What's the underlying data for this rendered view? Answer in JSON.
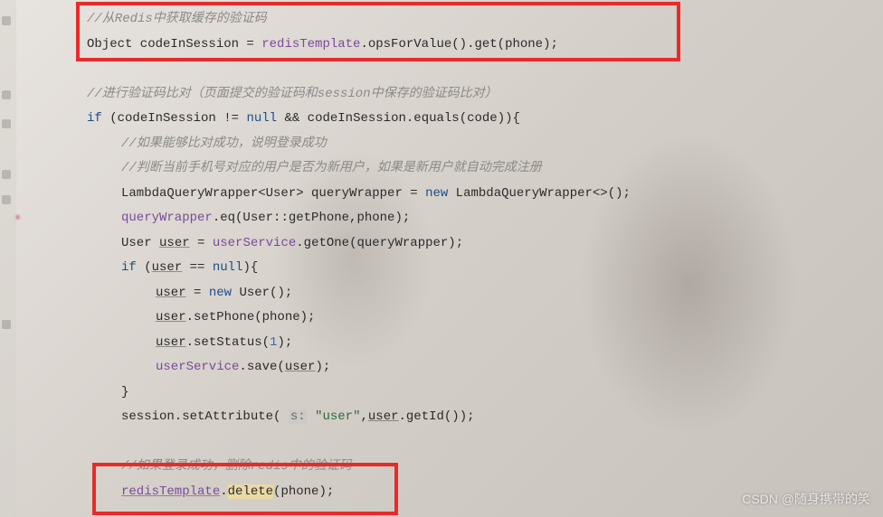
{
  "code": {
    "c1": "//从Redis中获取缓存的验证码",
    "l2a": "Object codeInSession = ",
    "l2b": "redisTemplate",
    "l2c": ".opsForValue().get(phone);",
    "c2": "//进行验证码比对（页面提交的验证码和session中保存的验证码比对）",
    "l4a": "if",
    "l4b": " (codeInSession != ",
    "l4c": "null",
    "l4d": " && codeInSession.equals(code)){",
    "c3": "//如果能够比对成功，说明登录成功",
    "c4": "//判断当前手机号对应的用户是否为新用户，如果是新用户就自动完成注册",
    "l7a": "LambdaQueryWrapper<User> queryWrapper = ",
    "l7b": "new",
    "l7c": " LambdaQueryWrapper<>();",
    "l8a": "queryWrapper",
    "l8b": ".eq(User::getPhone,phone);",
    "l9a": "User ",
    "l9b": "user",
    "l9c": " = ",
    "l9d": "userService",
    "l9e": ".getOne(queryWrapper);",
    "l10a": "if",
    "l10b": " (",
    "l10c": "user",
    "l10d": " == ",
    "l10e": "null",
    "l10f": "){",
    "l11a": "user",
    "l11b": " = ",
    "l11c": "new",
    "l11d": " User();",
    "l12a": "user",
    "l12b": ".setPhone(phone);",
    "l13a": "user",
    "l13b": ".setStatus(",
    "l13c": "1",
    "l13d": ");",
    "l14a": "userService",
    "l14b": ".save(",
    "l14c": "user",
    "l14d": ");",
    "l15": "}",
    "l16a": "session.setAttribute( ",
    "l16hint": "s:",
    "l16b": " ",
    "l16c": "\"user\"",
    "l16d": ",",
    "l16e": "user",
    "l16f": ".getId());",
    "c5": "//如果登录成功，删除redis中的验证码",
    "l18a": "redisTemplate",
    "l18b": ".",
    "l18c": "delete",
    "l18d": "(phone);"
  },
  "watermark": "CSDN @随身携带的笑"
}
